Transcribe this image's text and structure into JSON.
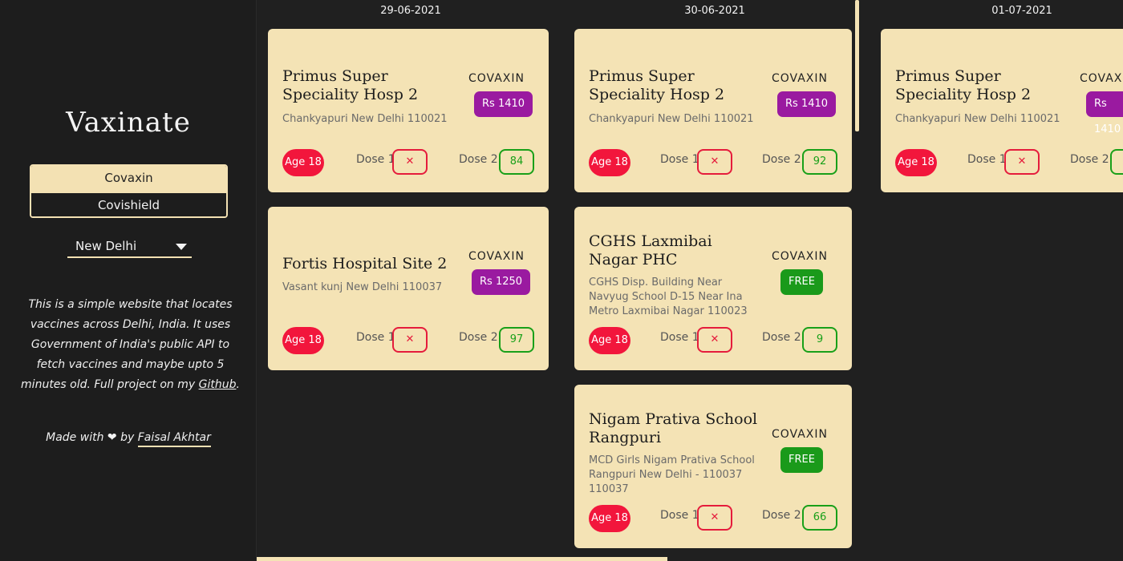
{
  "app": {
    "title": "Vaxinate"
  },
  "sidebar": {
    "vaccines": [
      "Covaxin",
      "Covishield"
    ],
    "selected_vaccine": "Covaxin",
    "city": "New Delhi",
    "about_before": "This is a simple website that locates vaccines across Delhi, India. It uses Government of India's public API to fetch vaccines and maybe upto 5 minutes old. Full project on my ",
    "about_link": "Github",
    "about_after": ".",
    "made_with": "Made with",
    "made_by": "by",
    "author": "Faisal Akhtar"
  },
  "days": [
    {
      "date": "29-06-2021",
      "centers": [
        {
          "name": "Primus Super Speciality Hosp 2",
          "address": "Chankyapuri New Delhi 110021",
          "vaccine": "COVAXIN",
          "price": "Rs 1410",
          "free": false,
          "age": "Age 18",
          "dose1_label": "Dose 1",
          "dose1": "✕",
          "dose2_label": "Dose 2",
          "dose2": "84"
        },
        {
          "name": "Fortis Hospital Site 2",
          "address": "Vasant kunj New Delhi 110037",
          "vaccine": "COVAXIN",
          "price": "Rs 1250",
          "free": false,
          "age": "Age 18",
          "dose1_label": "Dose 1",
          "dose1": "✕",
          "dose2_label": "Dose 2",
          "dose2": "97"
        }
      ]
    },
    {
      "date": "30-06-2021",
      "centers": [
        {
          "name": "Primus Super Speciality Hosp 2",
          "address": "Chankyapuri New Delhi 110021",
          "vaccine": "COVAXIN",
          "price": "Rs 1410",
          "free": false,
          "age": "Age 18",
          "dose1_label": "Dose 1",
          "dose1": "✕",
          "dose2_label": "Dose 2",
          "dose2": "92"
        },
        {
          "name": "CGHS Laxmibai Nagar PHC",
          "address": "CGHS Disp. Building Near Navyug School D-15 Near Ina Metro Laxmibai Nagar 110023",
          "vaccine": "COVAXIN",
          "price": "FREE",
          "free": true,
          "age": "Age 18",
          "dose1_label": "Dose 1",
          "dose1": "✕",
          "dose2_label": "Dose 2",
          "dose2": "9"
        },
        {
          "name": "Nigam Prativa School Rangpuri",
          "address": "MCD Girls Nigam Prativa School Rangpuri New Delhi - 110037 110037",
          "vaccine": "COVAXIN",
          "price": "FREE",
          "free": true,
          "age": "Age 18",
          "dose1_label": "Dose 1",
          "dose1": "✕",
          "dose2_label": "Dose 2",
          "dose2": "66"
        }
      ]
    },
    {
      "date": "01-07-2021",
      "centers": [
        {
          "name": "Primus Super Speciality Hosp 2",
          "address": "Chankyapuri New Delhi 110021",
          "vaccine": "COVAXIN",
          "price": "Rs 1410",
          "free": false,
          "age": "Age 18",
          "dose1_label": "Dose 1",
          "dose1": "✕",
          "dose2_label": "Dose 2",
          "dose2": ""
        }
      ]
    }
  ]
}
